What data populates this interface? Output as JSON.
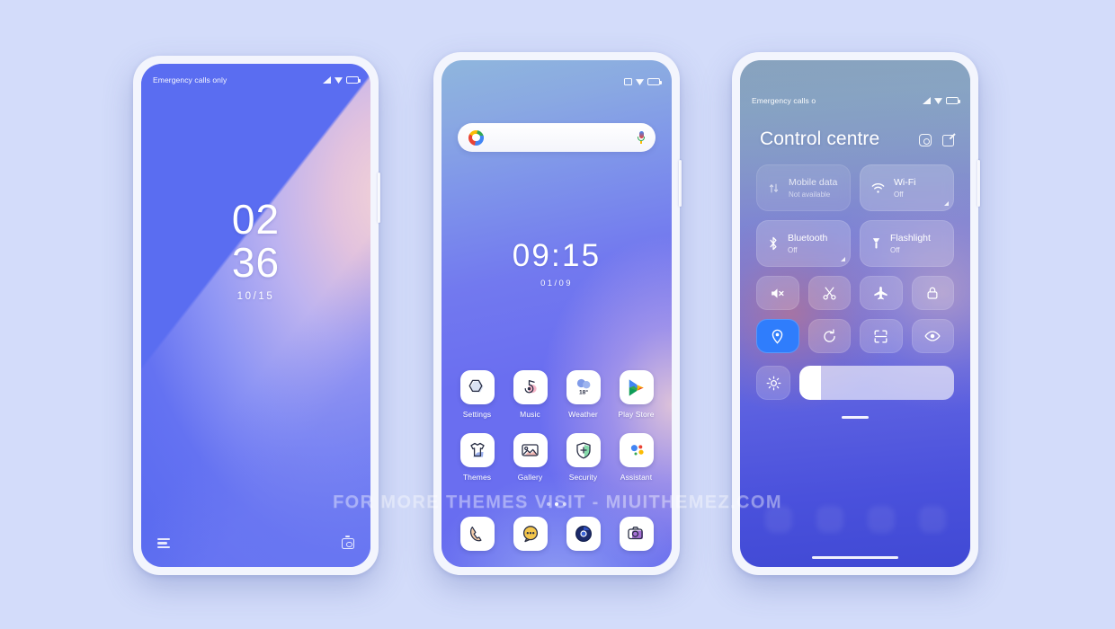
{
  "background_color": "#d3dcfa",
  "watermark": "FOR MORE THEMES VISIT - MIUITHEMEZ.COM",
  "lockscreen": {
    "status_text": "Emergency calls only",
    "status_icons": [
      "signal-icon",
      "wifi-icon",
      "battery-icon"
    ],
    "hours": "02",
    "minutes": "36",
    "date": "10/15",
    "bottom_left_icon": "shortcuts-icon",
    "bottom_right_icon": "camera-icon"
  },
  "homescreen": {
    "status_icons": [
      "alarm-icon",
      "wifi-icon",
      "battery-icon"
    ],
    "search": {
      "placeholder": "",
      "value": "",
      "logo": "google-logo",
      "mic": "microphone-icon"
    },
    "time": "09:15",
    "date": "01/09",
    "apps": [
      [
        {
          "label": "Settings",
          "icon": "settings-icon"
        },
        {
          "label": "Music",
          "icon": "music-icon"
        },
        {
          "label": "Weather",
          "icon": "weather-icon",
          "badge": "18°"
        },
        {
          "label": "Play Store",
          "icon": "play-store-icon"
        }
      ],
      [
        {
          "label": "Themes",
          "icon": "themes-icon"
        },
        {
          "label": "Gallery",
          "icon": "gallery-icon"
        },
        {
          "label": "Security",
          "icon": "security-icon"
        },
        {
          "label": "Assistant",
          "icon": "assistant-icon"
        }
      ]
    ],
    "dock": [
      {
        "label": "Phone",
        "icon": "phone-icon"
      },
      {
        "label": "Messages",
        "icon": "messages-icon"
      },
      {
        "label": "Browser",
        "icon": "chrome-icon"
      },
      {
        "label": "Camera",
        "icon": "camera-app-icon"
      }
    ],
    "page_dots": 3,
    "active_page": 1
  },
  "controlcentre": {
    "status_text": "Emergency calls o",
    "status_icons": [
      "signal-icon",
      "wifi-icon",
      "battery-icon"
    ],
    "title": "Control centre",
    "actions": [
      {
        "name": "screen-record-icon"
      },
      {
        "name": "edit-icon"
      }
    ],
    "big_tiles": [
      {
        "title": "Mobile data",
        "subtitle": "Not available",
        "icon": "mobile-data-icon",
        "state": "disabled",
        "expandable": false
      },
      {
        "title": "Wi-Fi",
        "subtitle": "Off",
        "icon": "wifi-tile-icon",
        "state": "off",
        "expandable": true
      },
      {
        "title": "Bluetooth",
        "subtitle": "Off",
        "icon": "bluetooth-icon",
        "state": "off",
        "expandable": true
      },
      {
        "title": "Flashlight",
        "subtitle": "Off",
        "icon": "flashlight-icon",
        "state": "off",
        "expandable": false
      }
    ],
    "small_tiles": [
      {
        "icon": "mute-icon",
        "state": "off"
      },
      {
        "icon": "scissors-icon",
        "state": "off"
      },
      {
        "icon": "airplane-icon",
        "state": "off"
      },
      {
        "icon": "lock-icon",
        "state": "off"
      },
      {
        "icon": "location-icon",
        "state": "on",
        "accent": "#2f7dfc"
      },
      {
        "icon": "rotate-icon",
        "state": "off"
      },
      {
        "icon": "scan-icon",
        "state": "off"
      },
      {
        "icon": "eye-icon",
        "state": "off"
      }
    ],
    "brightness": {
      "icon": "brightness-icon",
      "value_percent": 14
    }
  }
}
